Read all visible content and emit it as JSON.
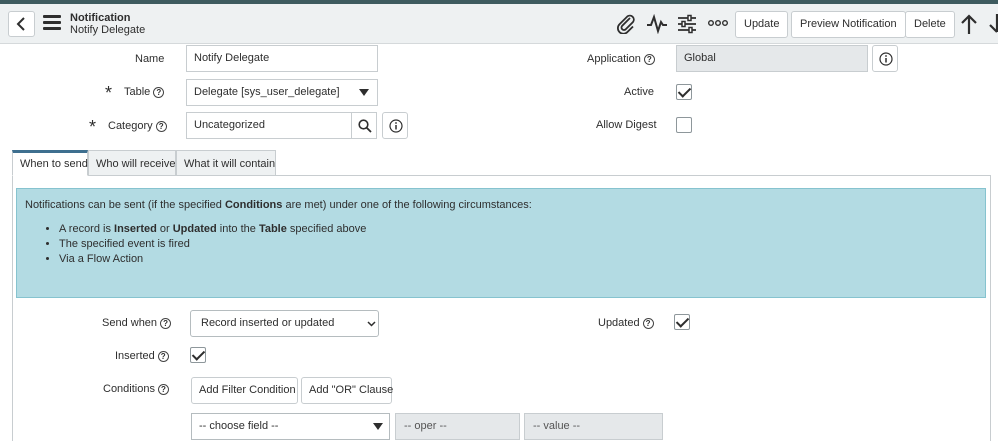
{
  "header": {
    "title": "Notification",
    "subtitle": "Notify Delegate",
    "buttons": {
      "update": "Update",
      "preview": "Preview Notification",
      "delete": "Delete"
    }
  },
  "form": {
    "name": {
      "label": "Name",
      "value": "Notify Delegate"
    },
    "table": {
      "label": "Table",
      "value": "Delegate [sys_user_delegate]"
    },
    "category": {
      "label": "Category",
      "value": "Uncategorized"
    },
    "application": {
      "label": "Application",
      "value": "Global"
    },
    "active": {
      "label": "Active",
      "checked": true
    },
    "allow_digest": {
      "label": "Allow Digest",
      "checked": false
    }
  },
  "tabs": [
    {
      "label": "When to send",
      "active": true
    },
    {
      "label": "Who will receive",
      "active": false
    },
    {
      "label": "What it will contain",
      "active": false
    }
  ],
  "info": {
    "intro_1": "Notifications can be sent (if the specified ",
    "intro_bold": "Conditions",
    "intro_2": " are met) under one of the following circumstances:",
    "item1": {
      "a": "A record is ",
      "b": "Inserted",
      "c": " or ",
      "d": "Updated",
      "e": " into the ",
      "f": "Table",
      "g": " specified above"
    },
    "item2": "The specified event is fired",
    "item3": "Via a Flow Action"
  },
  "when": {
    "send_when": {
      "label": "Send when",
      "value": "Record inserted or updated"
    },
    "updated": {
      "label": "Updated",
      "checked": true
    },
    "inserted": {
      "label": "Inserted",
      "checked": true
    },
    "conditions": {
      "label": "Conditions",
      "add_filter": "Add Filter Condition",
      "add_or": "Add \"OR\" Clause",
      "field_placeholder": "-- choose field --",
      "oper_placeholder": "-- oper --",
      "value_placeholder": "-- value --"
    }
  },
  "help_glyph": "?"
}
